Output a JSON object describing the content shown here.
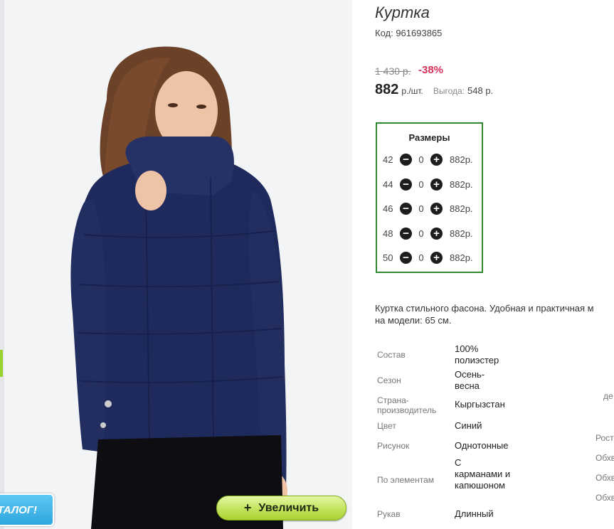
{
  "product": {
    "title": "Куртка",
    "code": "Код: 961693865",
    "old_price": "1 430 р.",
    "discount": "-38%",
    "price": "882",
    "price_unit": "р./шт.",
    "savings_label": "Выгода:",
    "savings_value": "548 р."
  },
  "gallery": {
    "zoom_label": "Увеличить",
    "zoom_icon": "plus-icon",
    "catalog_label": "ТАЛОГ!"
  },
  "sizes": {
    "title": "Размеры",
    "items": [
      {
        "size": "42",
        "qty": "0",
        "price": "882р."
      },
      {
        "size": "44",
        "qty": "0",
        "price": "882р."
      },
      {
        "size": "46",
        "qty": "0",
        "price": "882р."
      },
      {
        "size": "48",
        "qty": "0",
        "price": "882р."
      },
      {
        "size": "50",
        "qty": "0",
        "price": "882р."
      }
    ]
  },
  "description": {
    "line1": "Куртка стильного фасона. Удобная и практичная м",
    "line2": "на модели: 65 см."
  },
  "attributes": [
    {
      "label": "Состав",
      "value": "100% полиэстер"
    },
    {
      "label": "Сезон",
      "value": "Осень-весна"
    },
    {
      "label": "Страна-производитель",
      "value": "Кыргызстан"
    },
    {
      "label": "Цвет",
      "value": "Синий"
    },
    {
      "label": "Рисунок",
      "value": "Однотонные"
    },
    {
      "label": "По элементам",
      "value": "С карманами и капюшоном"
    },
    {
      "label": "Рукав",
      "value": "Длинный"
    }
  ],
  "side_labels": [
    "де",
    "Рост",
    "Обхв",
    "Обхв",
    "Обхв"
  ],
  "colors": {
    "accent_green": "#2f8a2f",
    "discount_red": "#d9305a",
    "jacket_navy": "#1f2a5c"
  }
}
